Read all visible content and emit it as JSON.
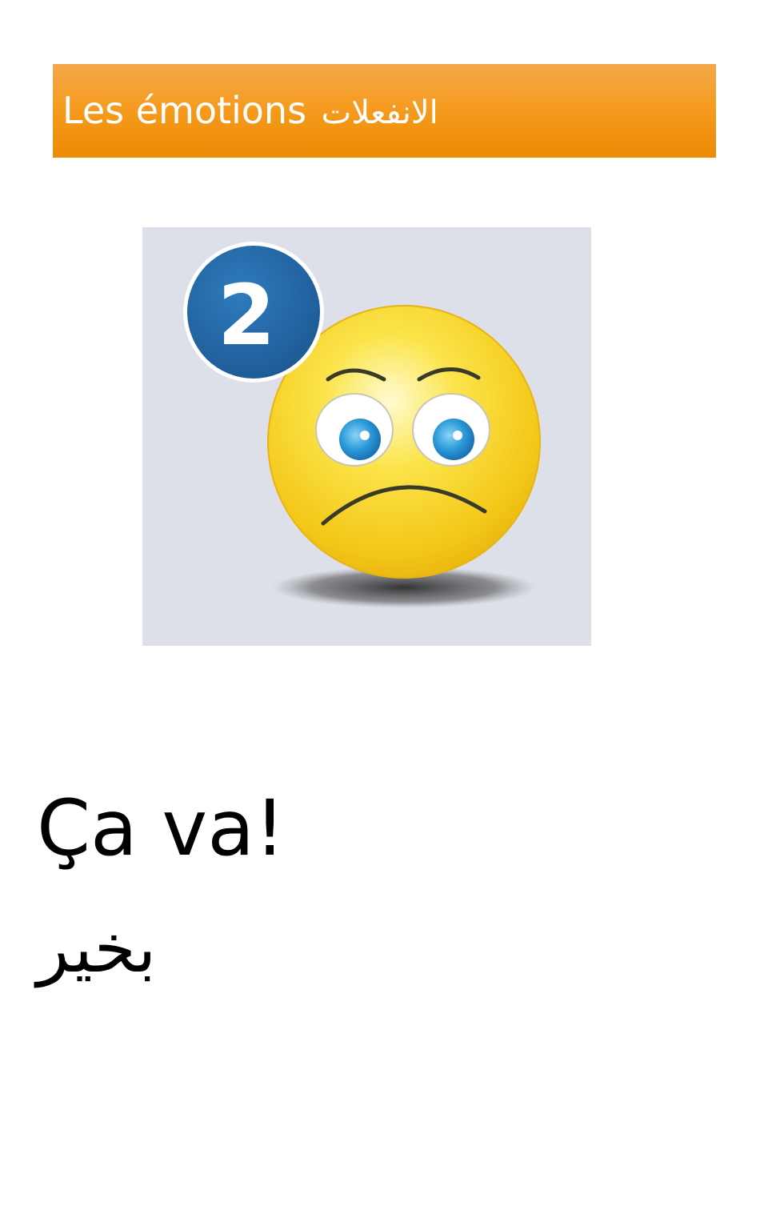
{
  "header": {
    "title_fr": "Les émotions",
    "title_ar": "الانفعلات"
  },
  "picture": {
    "badge_number": "2",
    "icon": "worried-face-icon",
    "badge_color": "#2366a3",
    "face_color": "#f6d11a",
    "background_color": "#dde0e8"
  },
  "caption": {
    "french": "Ça va!",
    "arabic": "بخير"
  },
  "colors": {
    "banner": "#f59a1c",
    "banner_text": "#ffffff"
  }
}
